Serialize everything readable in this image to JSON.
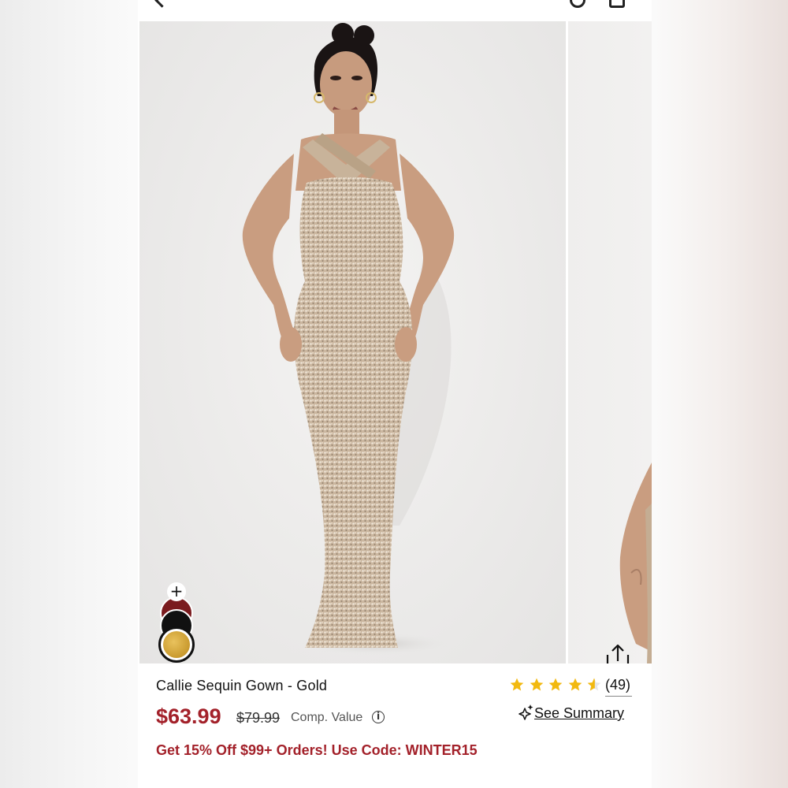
{
  "product": {
    "title": "Callie Sequin Gown - Gold",
    "price": "$63.99",
    "compare_price": "$79.99",
    "compare_label": "Comp. Value",
    "rating": 4.5,
    "review_count": "(49)",
    "summary_link": "See Summary",
    "promo": "Get 15% Off $99+ Orders! Use Code: WINTER15"
  },
  "swatches": {
    "add_label": "+",
    "colors": [
      "#7a1b1e",
      "#111111",
      "#d4a843"
    ],
    "selected": "gold"
  },
  "gallery": {
    "slide_count": 5,
    "active_slide": 1
  },
  "colors": {
    "accent": "#a3212a",
    "star": "#f2b90f",
    "gown": "#c9b39a"
  }
}
